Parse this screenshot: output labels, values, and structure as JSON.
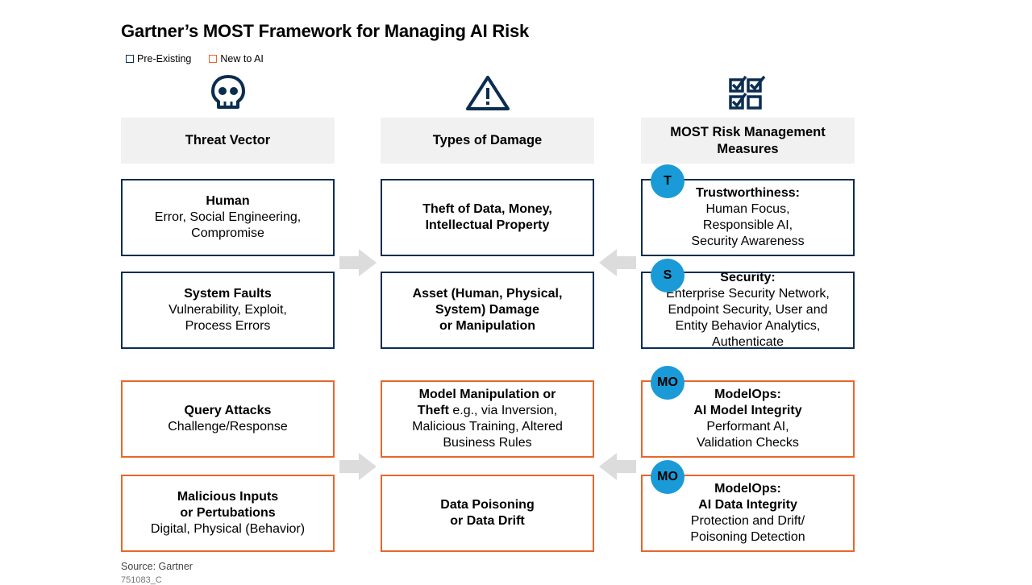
{
  "title": "Gartner’s MOST Framework for Managing AI Risk",
  "legend": {
    "pre_existing": "Pre-Existing",
    "new_to_ai": "New to AI"
  },
  "colors": {
    "pre_existing_border": "#0b2d50",
    "new_to_ai_border": "#e8662c",
    "badge": "#1a9bd7",
    "header_bg": "#f1f1f1",
    "arrow": "#dcdcdc"
  },
  "icons": {
    "threat": "skull-icon",
    "damage": "warning-triangle-icon",
    "measures": "checklist-icon"
  },
  "columns": {
    "threat": "Threat Vector",
    "damage": "Types of Damage",
    "measures": "MOST Risk Management\nMeasures"
  },
  "threats": [
    {
      "type": "pre-existing",
      "bold": "Human",
      "text": "Error, Social Engineering,\nCompromise"
    },
    {
      "type": "pre-existing",
      "bold": "System Faults",
      "text": "Vulnerability, Exploit,\nProcess Errors"
    },
    {
      "type": "new",
      "bold": "Query Attacks",
      "text": "Challenge/Response"
    },
    {
      "type": "new",
      "bold": "Malicious Inputs\nor Pertubations",
      "text": "Digital, Physical (Behavior)"
    }
  ],
  "damages": [
    {
      "type": "pre-existing",
      "bold": "Theft of Data, Money,\nIntellectual Property",
      "text": ""
    },
    {
      "type": "pre-existing",
      "bold": "Asset (Human, Physical,\nSystem) Damage\nor Manipulation",
      "text": ""
    },
    {
      "type": "new",
      "bold": "Model Manipulation or",
      "bold2": "Theft",
      "text2": " e.g., via Inversion,",
      "text": "Malicious Training, Altered\nBusiness Rules"
    },
    {
      "type": "new",
      "bold": "Data Poisoning\nor Data Drift",
      "text": ""
    }
  ],
  "measures": [
    {
      "type": "pre-existing",
      "badge": "T",
      "bold": "Trustworthiness:",
      "text": "Human Focus,\nResponsible AI,\nSecurity Awareness"
    },
    {
      "type": "pre-existing",
      "badge": "S",
      "bold": "Security:",
      "text": "Enterprise Security Network,\nEndpoint Security, User and\nEntity Behavior Analytics,\nAuthenticate"
    },
    {
      "type": "new",
      "badge": "MO",
      "bold": "ModelOps:\nAI Model Integrity",
      "text": "Performant AI,\nValidation Checks"
    },
    {
      "type": "new",
      "badge": "MO",
      "bold": "ModelOps:\nAI Data Integrity",
      "text": "Protection and Drift/\nPoisoning Detection"
    }
  ],
  "source": "Source: Gartner",
  "source_id": "751083_C"
}
